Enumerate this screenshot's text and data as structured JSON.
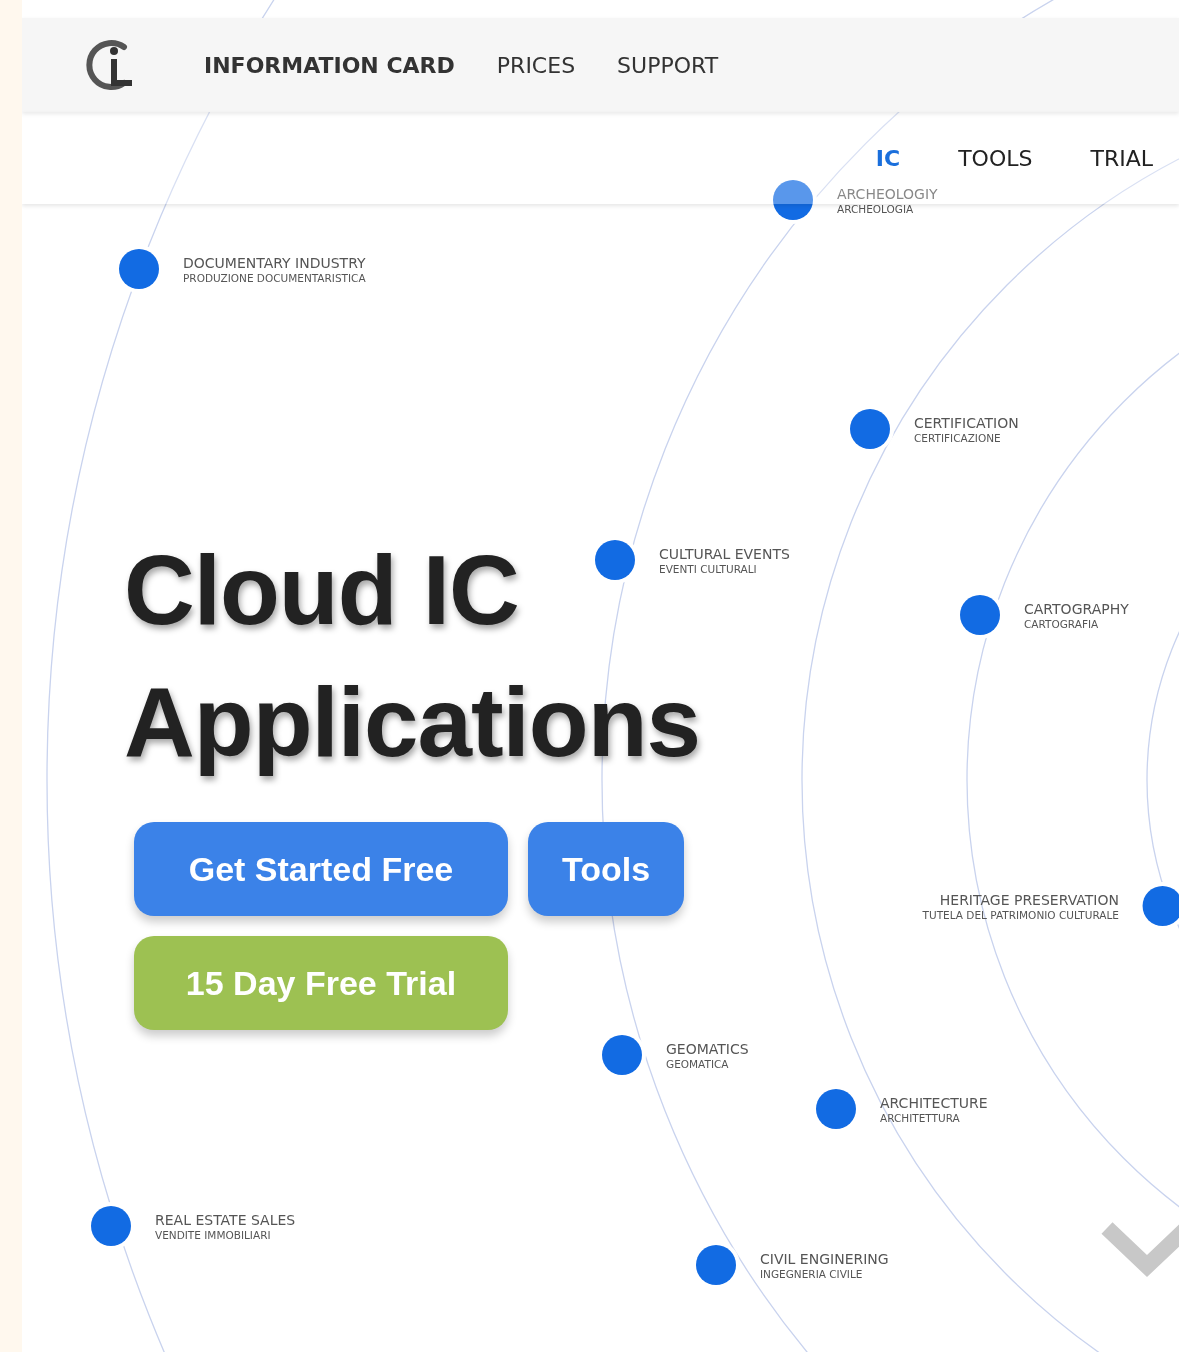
{
  "nav": {
    "items": [
      {
        "label": "INFORMATION CARD"
      },
      {
        "label": "PRICES"
      },
      {
        "label": "SUPPORT"
      }
    ]
  },
  "subnav": {
    "items": [
      {
        "label": "IC",
        "selected": true
      },
      {
        "label": "TOOLS",
        "selected": false
      },
      {
        "label": "TRIAL",
        "selected": false
      }
    ]
  },
  "hero": {
    "title_lines": [
      "Cloud IC",
      "Applications"
    ],
    "buttons": [
      {
        "label": "Get Started Free",
        "kind": "primary"
      },
      {
        "label": "Tools",
        "kind": "primary"
      },
      {
        "label": "15 Day Free Trial",
        "kind": "trial"
      }
    ]
  },
  "applications": [
    {
      "title": "ARCHEOLOGIY",
      "subtitle": "ARCHEOLOGIA",
      "kind": "right-label"
    },
    {
      "title": "DOCUMENTARY INDUSTRY",
      "subtitle": "PRODUZIONE DOCUMENTARISTICA",
      "kind": "right-label"
    },
    {
      "title": "CERTIFICATION",
      "subtitle": "CERTIFICAZIONE",
      "kind": "right-label"
    },
    {
      "title": "CULTURAL EVENTS",
      "subtitle": "EVENTI CULTURALI",
      "kind": "right-label"
    },
    {
      "title": "CARTOGRAPHY",
      "subtitle": "CARTOGRAFIA",
      "kind": "right-label"
    },
    {
      "title": "HERITAGE PRESERVATION",
      "subtitle": "TUTELA DEL PATRIMONIO CULTURALE",
      "kind": "left-label"
    },
    {
      "title": "GEOMATICS",
      "subtitle": "GEOMATICA",
      "kind": "right-label"
    },
    {
      "title": "ARCHITECTURE",
      "subtitle": "ARCHITETTURA",
      "kind": "right-label"
    },
    {
      "title": "REAL ESTATE SALES",
      "subtitle": "VENDITE IMMOBILIARI",
      "kind": "right-label"
    },
    {
      "title": "CIVIL ENGINERING",
      "subtitle": "INGEGNERIA CIVILE",
      "kind": "right-label"
    }
  ]
}
